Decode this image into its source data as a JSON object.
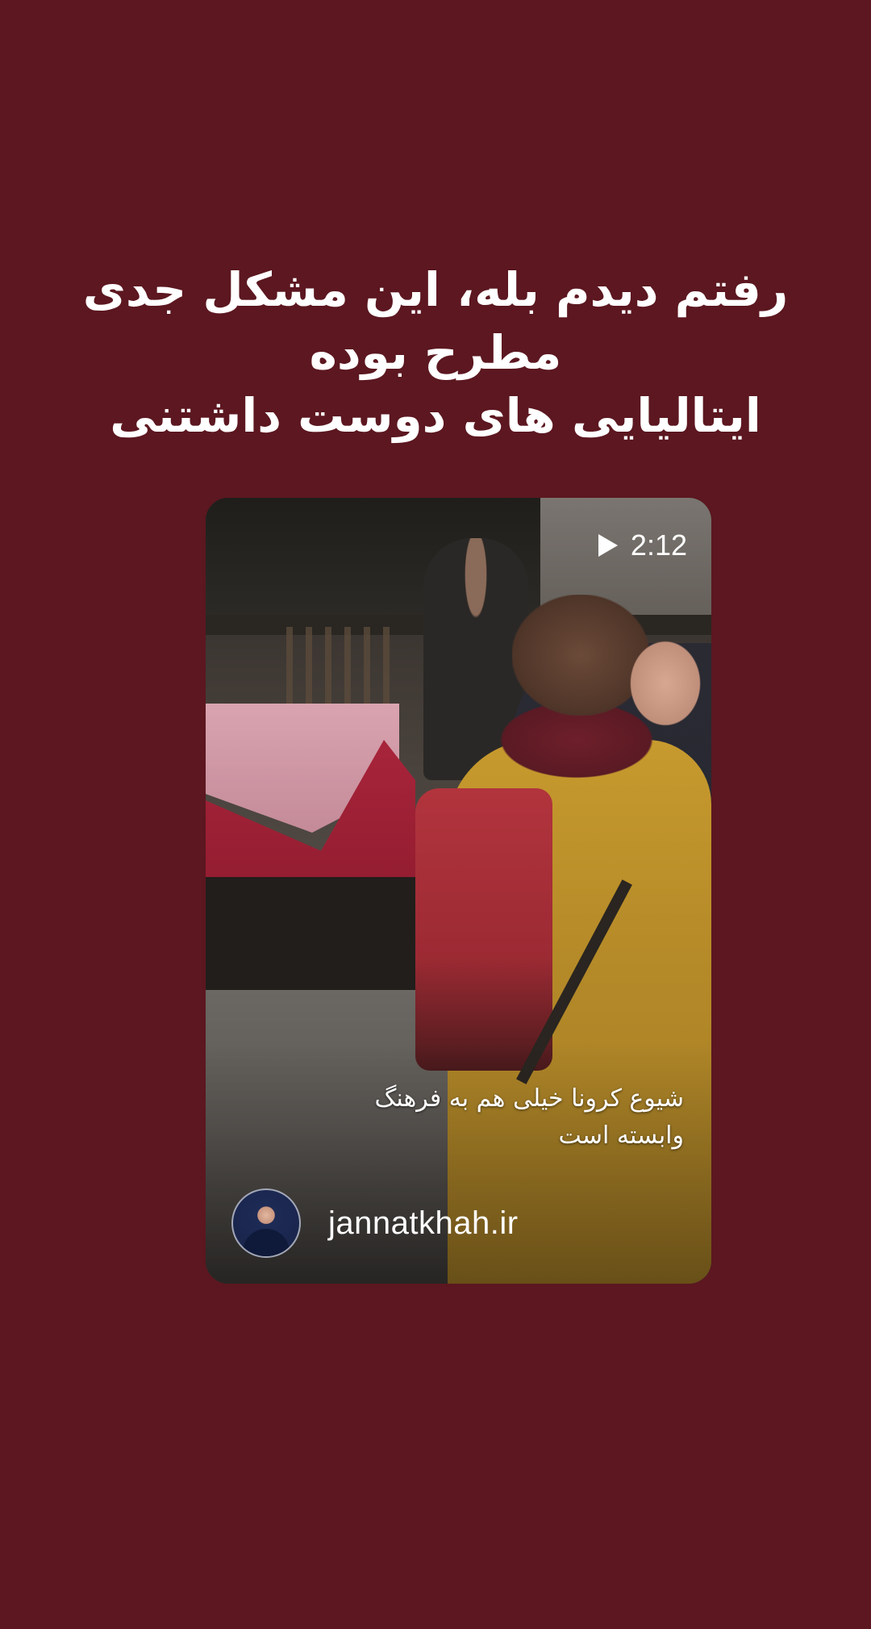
{
  "story": {
    "caption_lines": [
      "رفتم دیدم بله، این مشکل جدی",
      "مطرح بوده",
      "ایتالیایی های دوست داشتنی"
    ]
  },
  "post": {
    "duration": "2:12",
    "play_icon": "play-icon",
    "video_caption_lines": [
      "شیوع کرونا خیلی هم به فرهنگ",
      "وابسته است"
    ],
    "author": {
      "username": "jannatkhah.ir"
    }
  },
  "colors": {
    "background": "#5c1720",
    "text": "#ffffff"
  }
}
